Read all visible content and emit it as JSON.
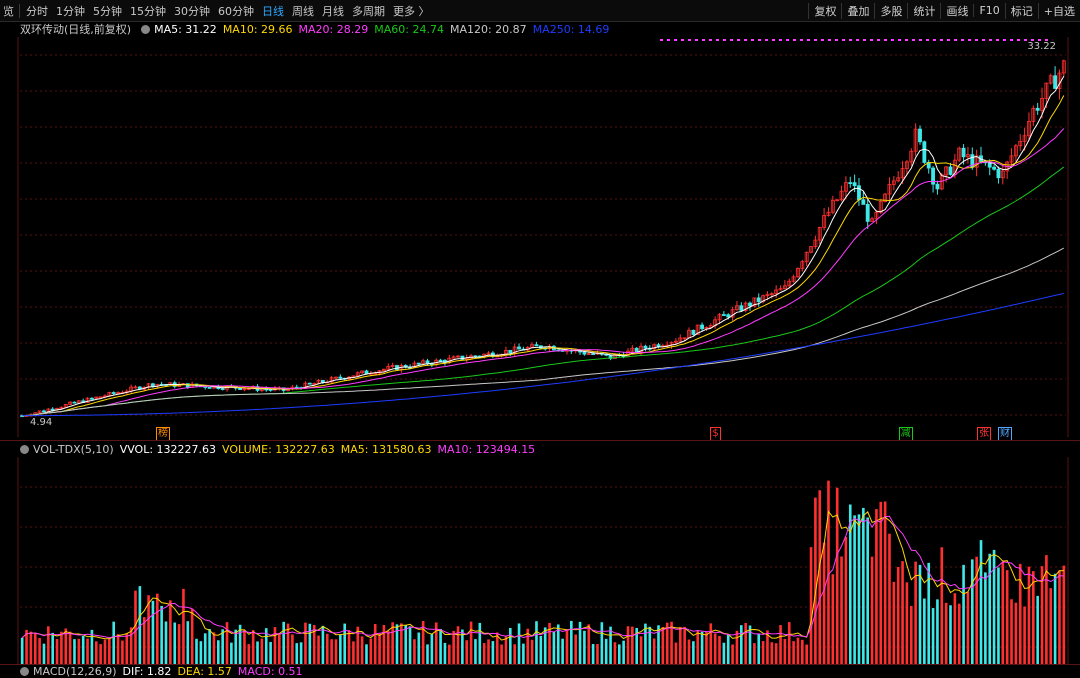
{
  "toolbar": {
    "left_stub": "览",
    "periods": [
      "分时",
      "1分钟",
      "5分钟",
      "15分钟",
      "30分钟",
      "60分钟",
      "日线",
      "周线",
      "月线",
      "多周期",
      "更多 〉"
    ],
    "active_period": "日线",
    "tools": [
      "复权",
      "叠加",
      "多股",
      "统计",
      "画线",
      "F10",
      "标记",
      "+自选"
    ]
  },
  "main_legend": {
    "title": "双环传动(日线,前复权)",
    "items": [
      {
        "label": "MA5: 31.22",
        "color": "#ffffff"
      },
      {
        "label": "MA10: 29.66",
        "color": "#ffd800"
      },
      {
        "label": "MA20: 28.29",
        "color": "#ff3cff"
      },
      {
        "label": "MA60: 24.74",
        "color": "#19c819"
      },
      {
        "label": "MA120: 20.87",
        "color": "#c8c8c8"
      },
      {
        "label": "MA250: 14.69",
        "color": "#1e3cff"
      }
    ]
  },
  "price_labels": {
    "high": "33.22",
    "low": "4.94"
  },
  "event_badges": [
    {
      "text": "榜",
      "color": "#ff8c00",
      "pos": 0.13
    },
    {
      "text": "$",
      "color": "#ff3030",
      "pos": 0.66
    },
    {
      "text": "减",
      "color": "#19c819",
      "pos": 0.84
    },
    {
      "text": "张",
      "color": "#ff3030",
      "pos": 0.915
    },
    {
      "text": "财",
      "color": "#4fa8ff",
      "pos": 0.935
    }
  ],
  "vol_legend": {
    "title": "VOL-TDX(5,10)",
    "items": [
      {
        "label": "VVOL: 132227.63",
        "color": "#ffffff"
      },
      {
        "label": "VOLUME: 132227.63",
        "color": "#ffd800"
      },
      {
        "label": "MA5: 131580.63",
        "color": "#ffd800"
      },
      {
        "label": "MA10: 123494.15",
        "color": "#ff3cff"
      }
    ]
  },
  "macd_legend": {
    "title": "MACD(12,26,9)",
    "items": [
      {
        "label": "DIF: 1.82",
        "color": "#ffffff"
      },
      {
        "label": "DEA: 1.57",
        "color": "#ffd800"
      },
      {
        "label": "MACD: 0.51",
        "color": "#ff3cff"
      }
    ]
  },
  "colors": {
    "up": "#ff3030",
    "down": "#3ce8e8",
    "grid": "#5a1414"
  }
}
